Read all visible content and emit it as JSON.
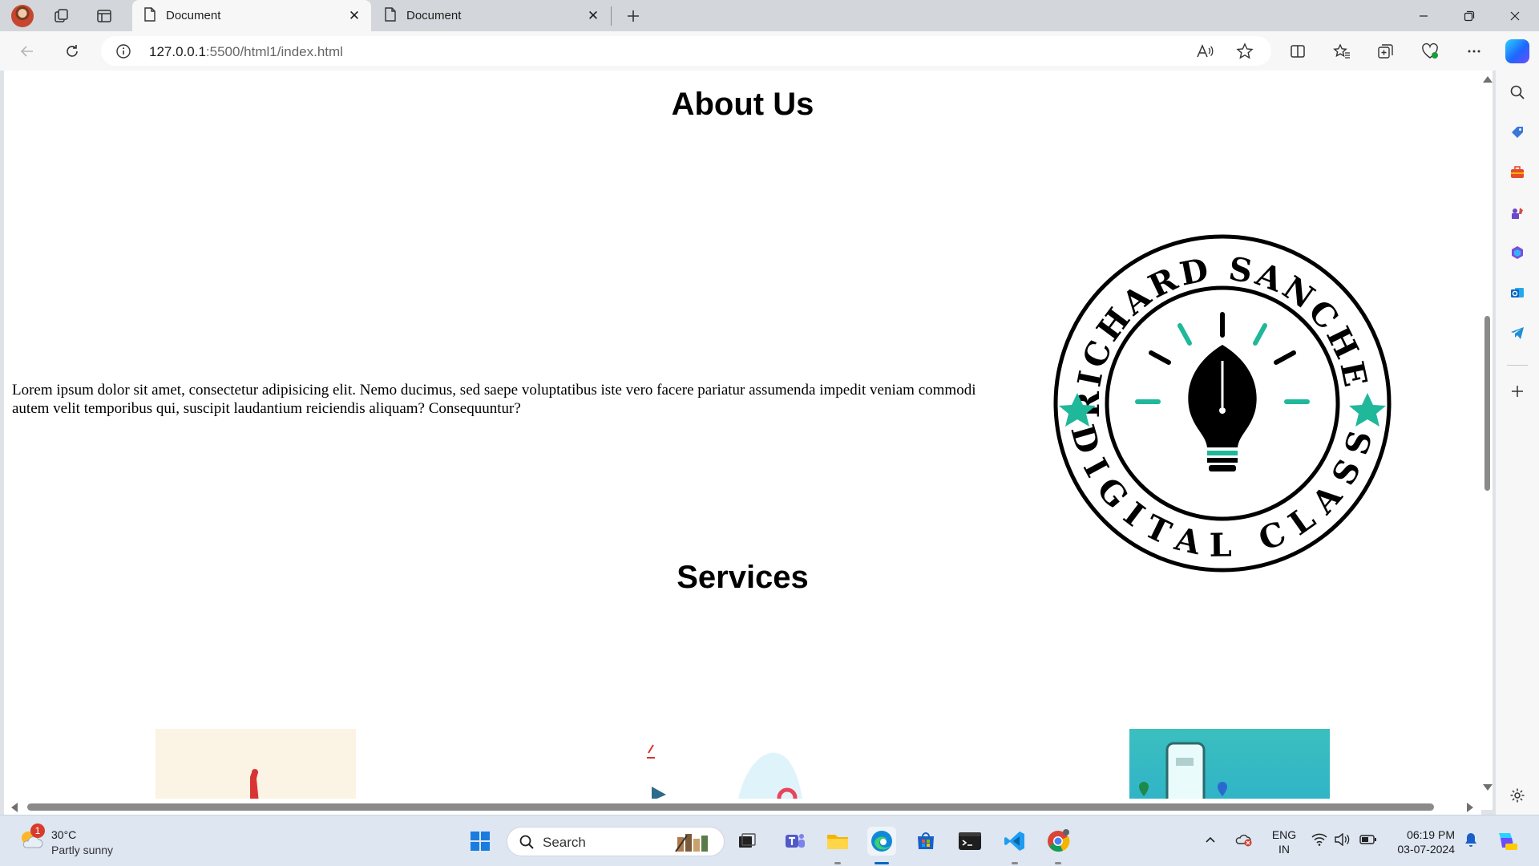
{
  "browser": {
    "tabs": [
      {
        "title": "Document",
        "active": true
      },
      {
        "title": "Document",
        "active": false
      }
    ],
    "url_host": "127.0.0.1",
    "url_rest": ":5500/html1/index.html"
  },
  "page": {
    "about": {
      "heading": "About Us",
      "text": "Lorem ipsum dolor sit amet, consectetur adipisicing elit. Nemo ducimus, sed saepe voluptatibus iste vero facere pariatur assumenda impedit veniam commodi autem velit temporibus qui, suscipit laudantium reiciendis aliquam? Consequuntur?"
    },
    "logo": {
      "top_text": "RICHARD SANCHEZ",
      "bottom_text": "DIGITAL CLASS",
      "accent_color": "#1fb89a"
    },
    "services": {
      "heading": "Services"
    }
  },
  "taskbar": {
    "weather_temp": "30°C",
    "weather_desc": "Partly sunny",
    "weather_badge": "1",
    "search_label": "Search",
    "lang_line1": "ENG",
    "lang_line2": "IN",
    "time": "06:19 PM",
    "date": "03-07-2024"
  }
}
